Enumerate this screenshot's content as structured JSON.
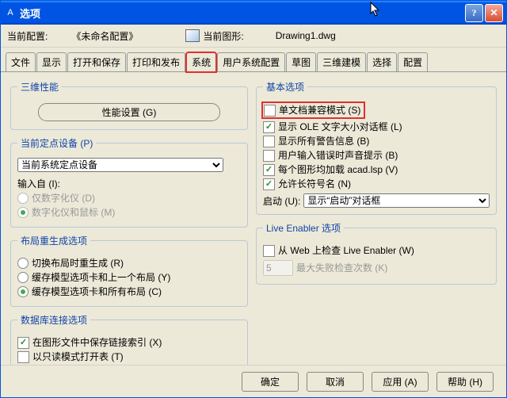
{
  "titlebar": {
    "icon_text": "A",
    "title": "选项"
  },
  "toolbar": {
    "config_label": "当前配置:",
    "config_value": "《未命名配置》",
    "drawing_label": "当前图形:",
    "drawing_value": "Drawing1.dwg"
  },
  "tabs": [
    "文件",
    "显示",
    "打开和保存",
    "打印和发布",
    "系统",
    "用户系统配置",
    "草图",
    "三维建模",
    "选择",
    "配置"
  ],
  "left": {
    "perf3d": {
      "legend": "三维性能",
      "btn": "性能设置 (G)"
    },
    "pointing": {
      "legend": "当前定点设备 (P)",
      "combo": "当前系统定点设备",
      "accept_label": "输入自 (I):",
      "opt1": "仅数字化仪 (D)",
      "opt2": "数字化仪和鼠标 (M)"
    },
    "regen": {
      "legend": "布局重生成选项",
      "opt1": "切换布局时重生成 (R)",
      "opt2": "缓存模型选项卡和上一个布局 (Y)",
      "opt3": "缓存模型选项卡和所有布局 (C)"
    },
    "dbconn": {
      "legend": "数据库连接选项",
      "opt1": "在图形文件中保存链接索引 (X)",
      "opt2": "以只读模式打开表 (T)"
    }
  },
  "right": {
    "basic": {
      "legend": "基本选项",
      "opt1": "单文档兼容模式 (S)",
      "opt2": "显示 OLE 文字大小对话框 (L)",
      "opt3": "显示所有警告信息 (B)",
      "opt4": "用户输入错误时声音提示 (B)",
      "opt5": "每个图形均加载 acad.lsp (V)",
      "opt6": "允许长符号名 (N)",
      "launch_label": "启动 (U):",
      "launch_value": "显示“启动”对话框"
    },
    "live": {
      "legend": "Live Enabler 选项",
      "opt1": "从 Web 上检查 Live Enabler (W)",
      "num": "5",
      "num_label": "最大失败检查次数 (K)"
    }
  },
  "buttons": {
    "ok": "确定",
    "cancel": "取消",
    "apply": "应用 (A)",
    "help": "帮助 (H)"
  }
}
